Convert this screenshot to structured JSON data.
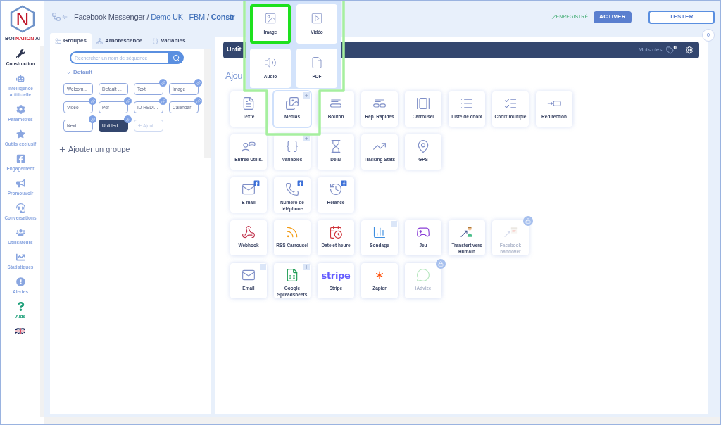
{
  "logo": {
    "letter": "N",
    "name_start": "BOT",
    "name_accent": "NATION",
    "name_end": " AI"
  },
  "sidebar": {
    "items": [
      {
        "kind": "nav",
        "label": "Construction",
        "selected": true
      },
      {
        "kind": "nav",
        "label": "Intelligence artificielle",
        "selected": false
      },
      {
        "kind": "nav",
        "label": "Paramètres",
        "selected": false
      },
      {
        "kind": "nav",
        "label": "Outils exclusif",
        "selected": false
      },
      {
        "kind": "nav",
        "label": "Engagement",
        "selected": false
      },
      {
        "kind": "nav",
        "label": "Promouvoir",
        "selected": false
      },
      {
        "kind": "nav",
        "label": "Conversations",
        "selected": false
      },
      {
        "kind": "nav",
        "label": "Utilisateurs",
        "selected": false
      },
      {
        "kind": "nav",
        "label": "Statistiques",
        "selected": false
      },
      {
        "kind": "nav",
        "label": "Alertes",
        "selected": false
      },
      {
        "kind": "help",
        "label": "Aide",
        "selected": false
      },
      {
        "kind": "language",
        "selected": false
      }
    ]
  },
  "breadcrumb": {
    "platform": "Facebook Messenger",
    "separator": "/",
    "bot": "Demo UK - FBM",
    "separator_2": "/",
    "page": "Constr"
  },
  "status": {
    "saved": "ENREGISTRÉ",
    "activate": "ACTIVER",
    "test": "TESTER"
  },
  "left_panel": {
    "tabs": [
      {
        "label": "Groupes",
        "selected": true
      },
      {
        "label": "Arborescence",
        "selected": false
      },
      {
        "label": "Variables",
        "selected": false
      }
    ],
    "search": {
      "placeholder": "Rechercher un nom de séquence"
    },
    "folder": {
      "name": "Default",
      "expanded": true
    },
    "groups": [
      {
        "kind": "group",
        "label": "Welcom...",
        "linked": false,
        "selected": false
      },
      {
        "kind": "group",
        "label": "Default ...",
        "linked": false,
        "selected": false
      },
      {
        "kind": "group",
        "label": "Text",
        "linked": true,
        "selected": false
      },
      {
        "kind": "group",
        "label": "Image",
        "linked": true,
        "selected": false
      },
      {
        "kind": "group",
        "label": "Video",
        "linked": true,
        "selected": false
      },
      {
        "kind": "group",
        "label": "Pdf",
        "linked": true,
        "selected": false
      },
      {
        "kind": "group",
        "label": "ID REDI...",
        "linked": true,
        "selected": false
      },
      {
        "kind": "group",
        "label": "Calendar",
        "linked": true,
        "selected": false
      },
      {
        "kind": "group",
        "label": "Next",
        "linked": true,
        "selected": false
      },
      {
        "kind": "group",
        "label": "Untitled...",
        "linked": true,
        "selected": true
      },
      {
        "kind": "add",
        "label": "Ajout ...",
        "linked": false,
        "selected": false
      }
    ],
    "add_group": "Ajouter un groupe"
  },
  "editor": {
    "notification_count": "0",
    "sequence_title": "Untit",
    "keywords_label": "Mots clés",
    "keywords_count": "0",
    "heading": "Ajou",
    "element_rows": [
      {
        "items": [
          {
            "label": "Texte",
            "locked": false,
            "expanded": false
          },
          {
            "label": "Médias",
            "locked": false,
            "expanded": true
          },
          {
            "label": "Bouton",
            "locked": false,
            "expanded": false
          },
          {
            "label": "Rép. Rapides",
            "locked": false,
            "expanded": false
          },
          {
            "label": "Carrousel",
            "locked": false,
            "expanded": false
          },
          {
            "label": "Liste de choix",
            "locked": false,
            "expanded": false
          },
          {
            "label": "Choix multiple",
            "locked": false,
            "expanded": false
          },
          {
            "label": "Redirection",
            "locked": false,
            "expanded": false
          }
        ]
      },
      {
        "items": [
          {
            "label": "Entrée Utilis.",
            "locked": false,
            "expanded": false
          },
          {
            "label": "Variables",
            "locked": false,
            "expanded": false
          },
          {
            "label": "Délai",
            "locked": false,
            "expanded": false
          },
          {
            "label": "Tracking Stats",
            "locked": false,
            "expanded": false
          },
          {
            "label": "GPS",
            "locked": false,
            "expanded": false
          }
        ]
      },
      {
        "items": [
          {
            "label": "E-mail",
            "locked": false,
            "expanded": false
          },
          {
            "label": "Numéro de téléphone",
            "locked": false,
            "expanded": false
          },
          {
            "label": "Relance",
            "locked": false,
            "expanded": false
          }
        ]
      },
      {
        "items": [
          {
            "label": "Webhook",
            "locked": false,
            "expanded": false
          },
          {
            "label": "RSS Carrousel",
            "locked": false,
            "expanded": false
          },
          {
            "label": "Date et heure",
            "locked": false,
            "expanded": false
          },
          {
            "label": "Sondage",
            "locked": false,
            "expanded": false
          },
          {
            "label": "Jeu",
            "locked": false,
            "expanded": false
          },
          {
            "label": "Transfert vers Humain",
            "locked": false,
            "expanded": false
          },
          {
            "label": "Facebook handover",
            "locked": true,
            "expanded": false
          }
        ]
      },
      {
        "items": [
          {
            "label": "Email",
            "locked": false,
            "expanded": false
          },
          {
            "label": "Google Spreadsheets",
            "locked": false,
            "expanded": false
          },
          {
            "label": "Stripe",
            "logo_text": "stripe",
            "locked": false,
            "expanded": false
          },
          {
            "label": "Zapier",
            "locked": false,
            "expanded": false
          },
          {
            "label": "iAdvize",
            "locked": true,
            "expanded": false
          }
        ]
      }
    ]
  },
  "media_menu": {
    "items": [
      {
        "label": "Image",
        "selected": true
      },
      {
        "label": "Vidéo",
        "selected": false
      },
      {
        "label": "Audio",
        "selected": false
      },
      {
        "label": "PDF",
        "selected": false
      }
    ]
  }
}
